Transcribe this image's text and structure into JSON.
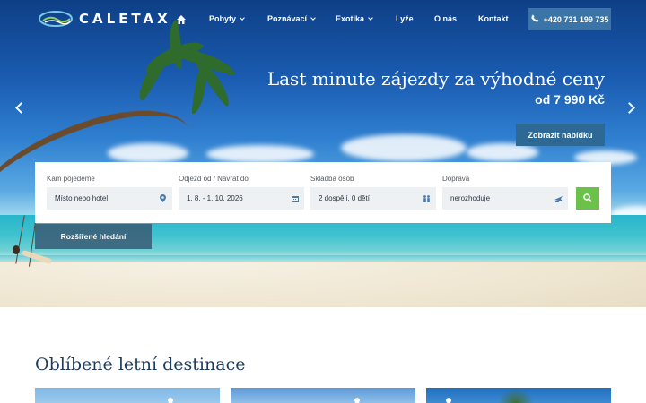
{
  "header": {
    "logo_text": "CALETAX",
    "nav": [
      {
        "label": "Pobyty",
        "has_dropdown": true
      },
      {
        "label": "Poznávací",
        "has_dropdown": true
      },
      {
        "label": "Exotika",
        "has_dropdown": true
      },
      {
        "label": "Lyže",
        "has_dropdown": false
      },
      {
        "label": "O nás",
        "has_dropdown": false
      },
      {
        "label": "Kontakt",
        "has_dropdown": false
      }
    ],
    "phone": "+420 731 199 735",
    "home_icon": "home-icon",
    "phone_icon": "phone-icon"
  },
  "slider": {
    "title": "Last minute zájezdy za výhodné ceny",
    "price": "od 7 990 Kč",
    "cta": "Zobrazit nabídku"
  },
  "search": {
    "destination": {
      "label": "Kam pojedeme",
      "value": "Místo nebo hotel",
      "icon": "map-pin-icon"
    },
    "dates": {
      "label": "Odjezd od / Návrat do",
      "value": "1. 8. - 1. 10. 2026",
      "icon": "calendar-icon"
    },
    "people": {
      "label": "Skladba osob",
      "value": "2 dospělí, 0 dětí",
      "icon": "people-icon"
    },
    "transport": {
      "label": "Doprava",
      "value": "nerozhoduje",
      "icon": "transport-icon"
    },
    "search_icon": "search-icon",
    "advanced": "Rozšířené hledání"
  },
  "destinations": {
    "title": "Oblíbené letní destinace"
  },
  "colors": {
    "accent_green": "#6bc14a",
    "button_blue": "#2e6894",
    "title_navy": "#1d3c5e"
  }
}
